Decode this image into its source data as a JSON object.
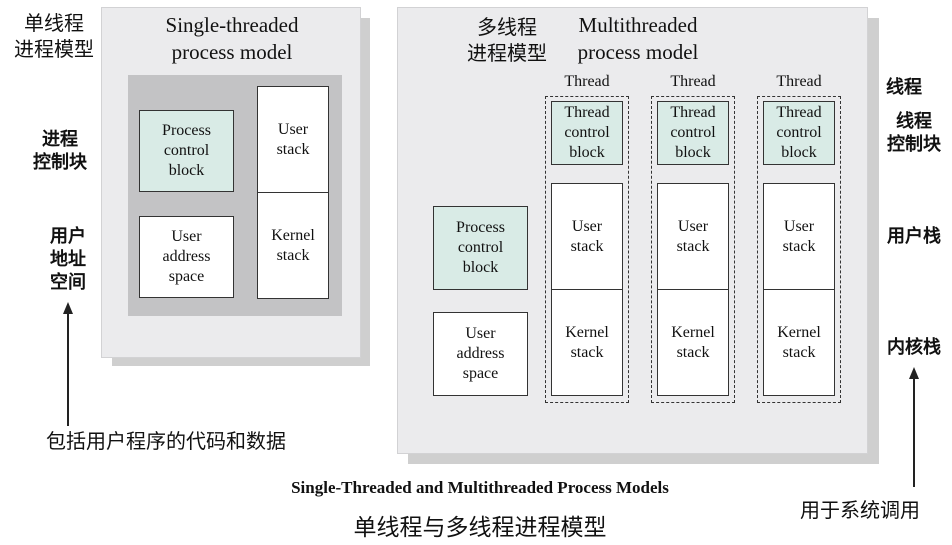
{
  "left_labels": {
    "single_model_cn": "单线程\n进程模型",
    "pcb_cn": "进程\n控制块",
    "user_addr_cn": "用户\n地址\n空间",
    "user_addr_note": "包括用户程序的代码和数据"
  },
  "single_panel": {
    "title": "Single-threaded\nprocess model",
    "pcb": "Process\ncontrol\nblock",
    "user_addr": "User\naddress\nspace",
    "user_stack": "User\nstack",
    "kernel_stack": "Kernel\nstack"
  },
  "multi_panel": {
    "title_cn": "多线程\n进程模型",
    "title_en": "Multithreaded\nprocess model",
    "pcb": "Process\ncontrol\nblock",
    "user_addr": "User\naddress\nspace",
    "threads": [
      {
        "label": "Thread",
        "tcb": "Thread\ncontrol\nblock",
        "user_stack": "User\nstack",
        "kernel_stack": "Kernel\nstack"
      },
      {
        "label": "Thread",
        "tcb": "Thread\ncontrol\nblock",
        "user_stack": "User\nstack",
        "kernel_stack": "Kernel\nstack"
      },
      {
        "label": "Thread",
        "tcb": "Thread\ncontrol\nblock",
        "user_stack": "User\nstack",
        "kernel_stack": "Kernel\nstack"
      }
    ]
  },
  "right_labels": {
    "thread_cn": "线程",
    "tcb_cn": "线程\n控制块",
    "user_stack_cn": "用户栈",
    "kernel_stack_cn": "内核栈",
    "kernel_note": "用于系统调用"
  },
  "caption": {
    "en": "Single-Threaded and Multithreaded Process Models",
    "cn": "单线程与多线程进程模型"
  }
}
